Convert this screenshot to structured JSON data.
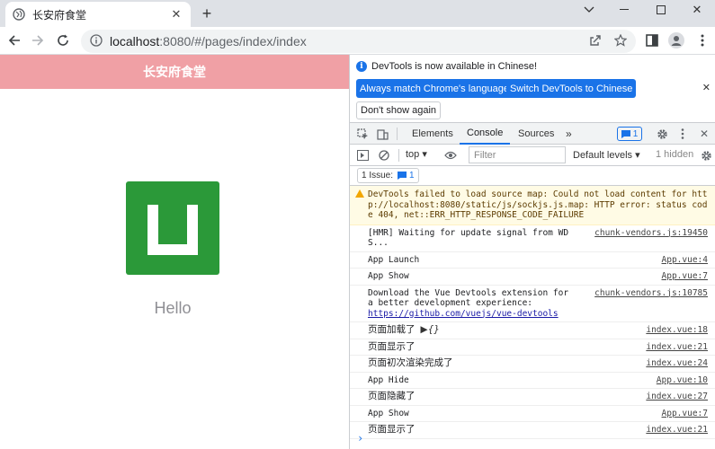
{
  "browser": {
    "tab": {
      "title": "长安府食堂"
    },
    "url": {
      "host": "localhost",
      "rest": ":8080/#/pages/index/index"
    }
  },
  "page": {
    "header_title": "长安府食堂",
    "hello_text": "Hello"
  },
  "devtools": {
    "infobar": {
      "message": "DevTools is now available in Chinese!",
      "match_button": "Always match Chrome's language",
      "switch_button": "Switch DevTools to Chinese",
      "dont_show_button": "Don't show again"
    },
    "tabs": [
      "Elements",
      "Console",
      "Sources"
    ],
    "active_tab": "Console",
    "message_count": "1",
    "console_toolbar": {
      "context": "top",
      "filter_placeholder": "Filter",
      "levels": "Default levels",
      "hidden": "1 hidden"
    },
    "issues": {
      "label": "1 Issue:",
      "count": "1"
    },
    "messages": [
      {
        "type": "warning",
        "text": "DevTools failed to load source map: Could not load content for http://localhost:8080/static/js/sockjs.js.map: HTTP error: status code 404, net::ERR_HTTP_RESPONSE_CODE_FAILURE",
        "source": ""
      },
      {
        "type": "log",
        "text": "[HMR] Waiting for update signal from WDS...",
        "source": "chunk-vendors.js:19450"
      },
      {
        "type": "log",
        "text": "App Launch",
        "source": "App.vue:4"
      },
      {
        "type": "log",
        "text": "App Show",
        "source": "App.vue:7"
      },
      {
        "type": "log",
        "text": "Download the Vue Devtools extension for a better development experience:",
        "link": "https://github.com/vuejs/vue-devtools",
        "source": "chunk-vendors.js:10785"
      },
      {
        "type": "log",
        "text": "页面加载了",
        "object": "▶{}",
        "source": "index.vue:18",
        "cjk": true
      },
      {
        "type": "log",
        "text": "页面显示了",
        "source": "index.vue:21",
        "cjk": true
      },
      {
        "type": "log",
        "text": "页面初次渲染完成了",
        "source": "index.vue:24",
        "cjk": true
      },
      {
        "type": "log",
        "text": "App Hide",
        "source": "App.vue:10"
      },
      {
        "type": "log",
        "text": "页面隐藏了",
        "source": "index.vue:27",
        "cjk": true
      },
      {
        "type": "log",
        "text": "App Show",
        "source": "App.vue:7"
      },
      {
        "type": "log",
        "text": "页面显示了",
        "source": "index.vue:21",
        "cjk": true
      }
    ],
    "prompt": "›"
  },
  "colors": {
    "header_pink": "#f0a0a5",
    "logo_green": "#2b9939",
    "devtools_blue": "#1a73e8",
    "warning_bg": "#fffbe5"
  }
}
